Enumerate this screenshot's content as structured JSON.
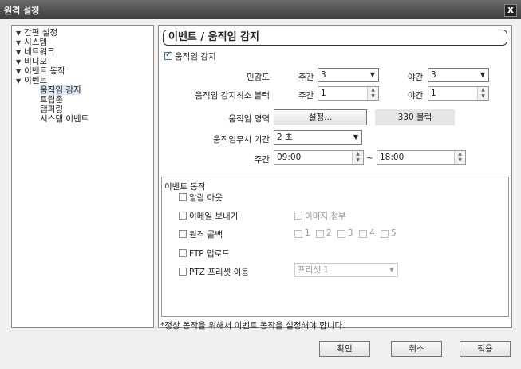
{
  "window": {
    "title": "원격 설정",
    "close_label": "x"
  },
  "tree": {
    "items": [
      {
        "label": "간편 설정",
        "expanded": true
      },
      {
        "label": "시스템",
        "expanded": true
      },
      {
        "label": "네트워크",
        "expanded": true
      },
      {
        "label": "비디오",
        "expanded": true
      },
      {
        "label": "이벤트 동작",
        "expanded": true
      },
      {
        "label": "이벤트",
        "expanded": true
      }
    ],
    "children": [
      "움직임 감지",
      "트립존",
      "탬퍼링",
      "시스템 이벤트"
    ],
    "arrow_glyph": "▼"
  },
  "panel": {
    "title": "이벤트 / 움직임 감지",
    "motion_detect": {
      "label": "움직임 감지",
      "checked": true
    },
    "sensitivity": {
      "label": "민감도",
      "day_label": "주간",
      "day_value": "3",
      "night_label": "야간",
      "night_value": "3"
    },
    "min_block": {
      "label": "움직임 감지최소 블럭",
      "day_label": "주간",
      "day_value": "1",
      "night_label": "야간",
      "night_value": "1"
    },
    "area": {
      "label": "움직임 영역",
      "button": "설정...",
      "blocks": "330 블럭"
    },
    "ignore": {
      "label": "움직임무시 기간",
      "value": "2 초"
    },
    "daytime": {
      "label": "주간",
      "start": "09:00",
      "sep": "~",
      "end": "18:00"
    }
  },
  "events": {
    "title": "이벤트 동작",
    "alarm_out": {
      "label": "알람 아웃",
      "checked": false
    },
    "email": {
      "label": "이메일 보내기",
      "checked": false
    },
    "attach": {
      "label": "이미지 첨부",
      "checked": false
    },
    "callback": {
      "label": "원격 콜백",
      "checked": false
    },
    "callback_opts": [
      "1",
      "2",
      "3",
      "4",
      "5"
    ],
    "ftp": {
      "label": "FTP 업로드",
      "checked": false
    },
    "ptz": {
      "label": "PTZ 프리셋 이동",
      "checked": false,
      "preset": "프리셋 1"
    }
  },
  "note": "*정상 동작을 위해서 이벤트 동작을 설정해야 합니다.",
  "buttons": {
    "ok": "확인",
    "cancel": "취소",
    "apply": "적용"
  }
}
